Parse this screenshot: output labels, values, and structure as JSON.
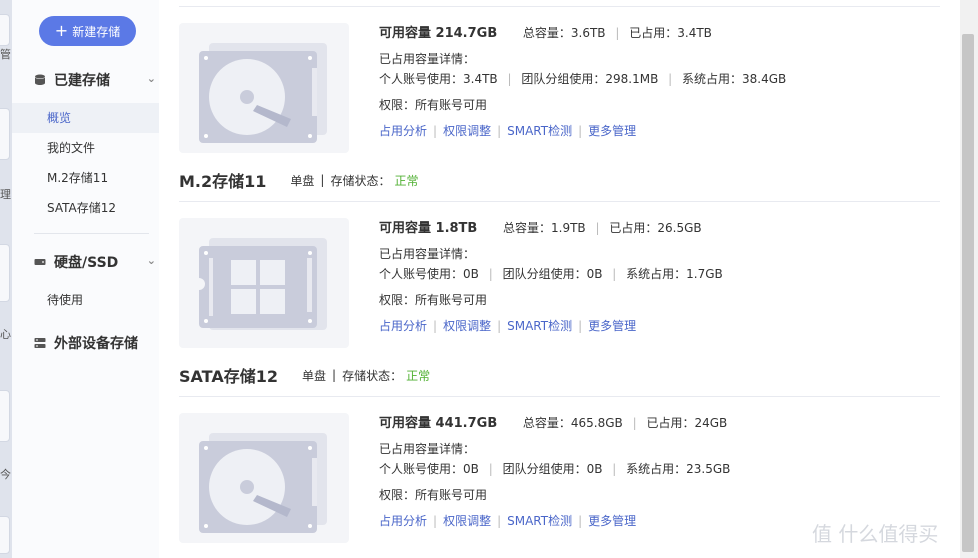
{
  "left_strip": {
    "chars": [
      "管",
      "理",
      "心",
      "今"
    ]
  },
  "sidebar": {
    "new_button": "新建存储",
    "built_group": "已建存储",
    "items": [
      "概览",
      "我的文件",
      "M.2存储11",
      "SATA存储12"
    ],
    "hdd_group": "硬盘/SSD",
    "hdd_items": [
      "待使用"
    ],
    "external_group": "外部设备存储"
  },
  "cards": [
    {
      "available": "可用容量 214.7GB",
      "total": "总容量：3.6TB",
      "used": "已占用：3.4TB",
      "detail_title": "已占用容量详情：",
      "personal": "个人账号使用：3.4TB",
      "team": "团队分组使用：298.1MB",
      "system": "系统占用：38.4GB",
      "perm": "权限：所有账号可用",
      "links": [
        "占用分析",
        "权限调整",
        "SMART检测",
        "更多管理"
      ],
      "icon": "hdd-icon"
    },
    {
      "section_title": "M.2存储11",
      "section_type": "单盘",
      "section_status_label": "存储状态：",
      "section_status": "正常",
      "available": "可用容量 1.8TB",
      "total": "总容量：1.9TB",
      "used": "已占用：26.5GB",
      "detail_title": "已占用容量详情：",
      "personal": "个人账号使用：0B",
      "team": "团队分组使用：0B",
      "system": "系统占用：1.7GB",
      "perm": "权限：所有账号可用",
      "links": [
        "占用分析",
        "权限调整",
        "SMART检测",
        "更多管理"
      ],
      "icon": "ssd-icon"
    },
    {
      "section_title": "SATA存储12",
      "section_type": "单盘",
      "section_status_label": "存储状态：",
      "section_status": "正常",
      "available": "可用容量 441.7GB",
      "total": "总容量：465.8GB",
      "used": "已占用：24GB",
      "detail_title": "已占用容量详情：",
      "personal": "个人账号使用：0B",
      "team": "团队分组使用：0B",
      "system": "系统占用：23.5GB",
      "perm": "权限：所有账号可用",
      "links": [
        "占用分析",
        "权限调整",
        "SMART检测",
        "更多管理"
      ],
      "icon": "hdd-icon"
    }
  ],
  "watermark": "值 什么值得买",
  "colors": {
    "accent": "#5b79e6",
    "link": "#4a66c9",
    "ok": "#52b134"
  }
}
